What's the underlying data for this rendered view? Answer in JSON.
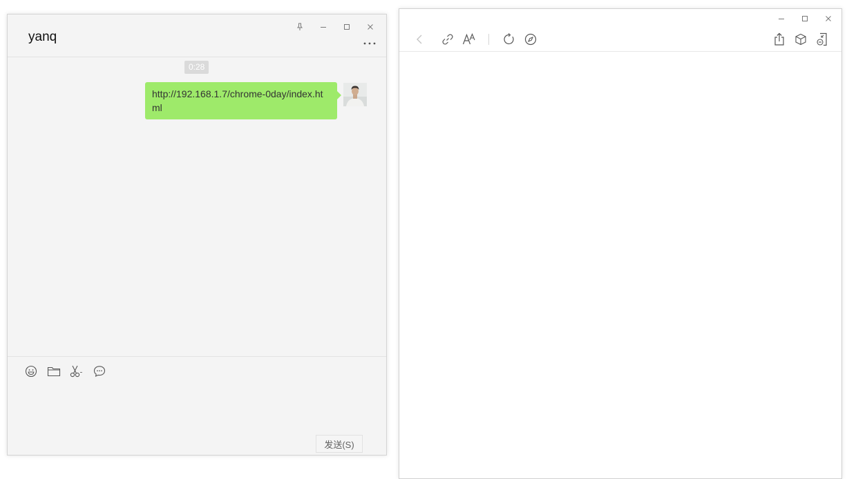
{
  "chat": {
    "contact_name": "yanq",
    "timestamp": "0:28",
    "message": "http://192.168.1.7/chrome-0day/index.html",
    "send_label": "发送(S)"
  },
  "browser": {},
  "colors": {
    "bubble": "#9eea6a",
    "chat_bg": "#f4f4f4",
    "icon_gray": "#666666"
  },
  "icons": {
    "chat_toolbar": [
      "emoji-icon",
      "folder-icon",
      "scissors-icon",
      "chat-history-icon"
    ],
    "browser_toolbar": [
      "back-icon",
      "link-icon",
      "font-size-icon",
      "refresh-icon",
      "compass-icon",
      "share-icon",
      "cube-icon",
      "minimize-to-window-icon"
    ]
  }
}
